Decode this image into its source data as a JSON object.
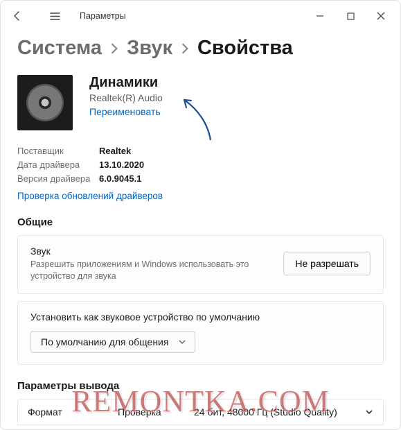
{
  "window": {
    "title": "Параметры"
  },
  "breadcrumb": {
    "a": "Система",
    "b": "Звук",
    "c": "Свойства"
  },
  "device": {
    "name": "Динамики",
    "subtitle": "Realtek(R) Audio",
    "rename_label": "Переименовать"
  },
  "driver": {
    "vendor_label": "Поставщик",
    "vendor_value": "Realtek",
    "date_label": "Дата драйвера",
    "date_value": "13.10.2020",
    "version_label": "Версия драйвера",
    "version_value": "6.0.9045.1",
    "check_updates": "Проверка обновлений драйверов"
  },
  "sections": {
    "general": "Общие",
    "output_params": "Параметры вывода"
  },
  "general_card": {
    "sound_title": "Звук",
    "sound_desc": "Разрешить приложениям и Windows использовать это устройство для звука",
    "deny_button": "Не разрешать",
    "set_default_title": "Установить как звуковое устройство по умолчанию",
    "default_dropdown": "По умолчанию для общения"
  },
  "output_table": {
    "col_format": "Формат",
    "col_check": "Проверка",
    "current_format": "24 бит, 48000 Гц (Studio Quality)"
  },
  "watermark": "REMONTKA.COM"
}
